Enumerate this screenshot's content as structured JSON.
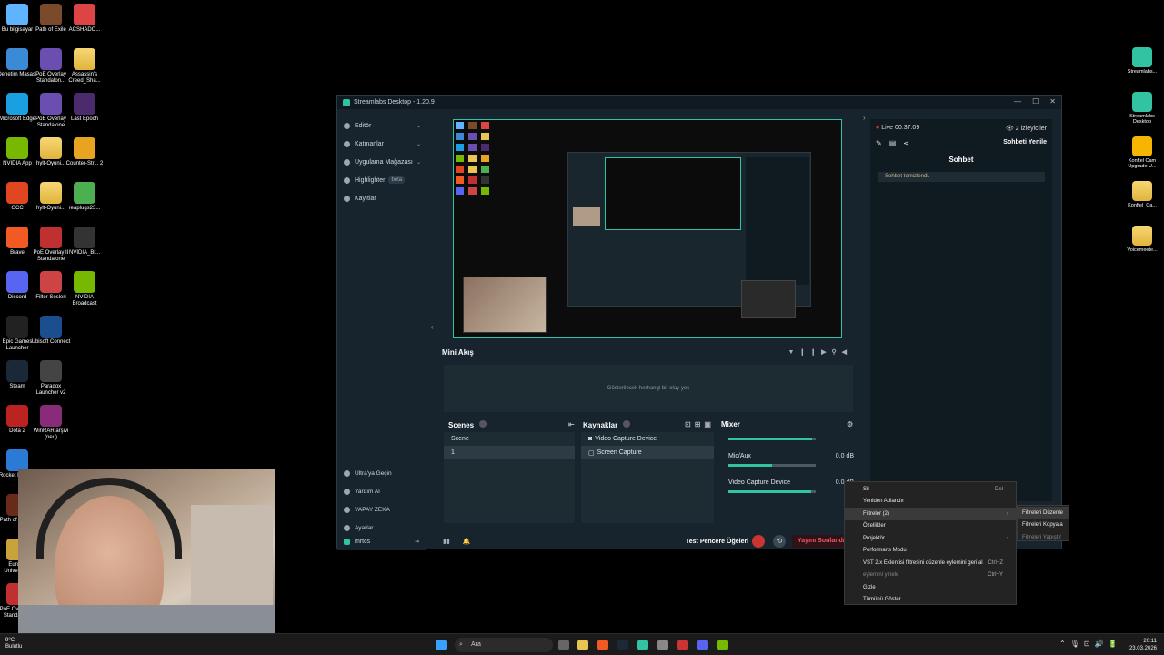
{
  "desktop_left": [
    {
      "label": "Bu bilgisayar",
      "color": "#5fb3ff"
    },
    {
      "label": "Path of Exile",
      "color": "#7a4a2a"
    },
    {
      "label": "ACSHADO...",
      "color": "#d44"
    },
    {
      "label": "Denetim Masası",
      "color": "#3a8ad6"
    },
    {
      "label": "PoE Overlay Standalon...",
      "color": "#6b4fb0"
    },
    {
      "label": "Assassin's Creed_Sha...",
      "color": "folder"
    },
    {
      "label": "Microsoft Edge",
      "color": "#1aa0e0"
    },
    {
      "label": "PoE Overlay Standalone",
      "color": "#6b4fb0"
    },
    {
      "label": "Last Epoch",
      "color": "#4b2a6e"
    },
    {
      "label": "NVIDIA App",
      "color": "#76b900"
    },
    {
      "label": "hylt-Oyuni...",
      "color": "folder"
    },
    {
      "label": "Counter-Str... 2",
      "color": "#e8a321"
    },
    {
      "label": "GCC",
      "color": "#e0461f"
    },
    {
      "label": "hylt-Oyuni...",
      "color": "folder"
    },
    {
      "label": "reaplugs23...",
      "color": "#4caf50"
    },
    {
      "label": "Brave",
      "color": "#f15a22"
    },
    {
      "label": "PoE Overlay II Standalone",
      "color": "#c03030"
    },
    {
      "label": "NVIDIA_Br...",
      "color": "#333"
    },
    {
      "label": "Discord",
      "color": "#5865f2"
    },
    {
      "label": "Filter Sesleri",
      "color": "#c44"
    },
    {
      "label": "NVIDIA Broadcast",
      "color": "#76b900"
    },
    {
      "label": "Epic Games Launcher",
      "color": "#222"
    },
    {
      "label": "Ubisoft Connect",
      "color": "#1a4e8f"
    },
    {
      "label": "Steam",
      "color": "#1b2838"
    },
    {
      "label": "Paradox Launcher v2",
      "color": "#444"
    },
    {
      "label": "Dota 2",
      "color": "#b22"
    },
    {
      "label": "WinRAR arşivi (neu)",
      "color": "#8a2b7a"
    },
    {
      "label": "Rocket League",
      "color": "#2a7bd6"
    },
    {
      "label": "Path of Exile 2",
      "color": "#6a2a1a"
    },
    {
      "label": "Europa Universalis",
      "color": "#c9a33a"
    },
    {
      "label": "PoE Overlay II Standalone",
      "color": "#c03030"
    }
  ],
  "desktop_right": [
    {
      "label": "Streamlabs...",
      "color": "#31c3a2"
    },
    {
      "label": "Streamlabs Desktop",
      "color": "#31c3a2"
    },
    {
      "label": "Konftel Cam Upgrade U...",
      "color": "#f6b500"
    },
    {
      "label": "Konftel_Ca...",
      "color": "folder"
    },
    {
      "label": "Voicemeete...",
      "color": "folder"
    }
  ],
  "window": {
    "title": "Streamlabs Desktop - 1.20.9",
    "nav": [
      {
        "label": "Editör",
        "chev": "⌄"
      },
      {
        "label": "Katmanlar",
        "chev": "⌄"
      },
      {
        "label": "Uygulama Mağazası",
        "chev": "⌄"
      },
      {
        "label": "Highlighter",
        "chev": ""
      },
      {
        "label": "Kayıtlar",
        "chev": ""
      }
    ],
    "highlighter_badge": "beta",
    "nav_bottom": [
      "Ultra'ya Geçin",
      "Yardım Al",
      "YAPAY ZEKA",
      "Ayarlar"
    ],
    "user": "mrtcs",
    "mini_feed_title": "Mini Akış",
    "mini_feed_empty": "Gösterilecek herhangi bir olay yok",
    "scenes_title": "Scenes",
    "scenes": [
      "Scene",
      "1"
    ],
    "sources_title": "Kaynaklar",
    "sources": [
      "Video Capture Device",
      "Screen Capture"
    ],
    "mixer_title": "Mixer",
    "mixer": [
      {
        "name": "Mic/Aux",
        "db": "0.0 dB",
        "level": 0.5
      },
      {
        "name": "Video Capture Device",
        "db": "0.0 dB",
        "level": 0.95
      }
    ],
    "test_label": "Test Pencere Öğeleri",
    "end_stream": "Yayını Sonlandır",
    "live_time": "Live 00:37:09",
    "viewers": "2 izleyiciler",
    "refresh_chat": "Sohbeti Yenile",
    "chat_title": "Sohbet",
    "chat_message": "Sohbet temizlendi."
  },
  "context_menu": {
    "items": [
      {
        "label": "Sil",
        "shortcut": "Del",
        "arrow": "",
        "dim": false,
        "hl": false
      },
      {
        "label": "Yeniden Adlandır",
        "shortcut": "",
        "arrow": "",
        "dim": false,
        "hl": false
      },
      {
        "label": "Filtreler (2)",
        "shortcut": "",
        "arrow": "›",
        "dim": false,
        "hl": true
      },
      {
        "label": "Özellikler",
        "shortcut": "",
        "arrow": "",
        "dim": false,
        "hl": false
      },
      {
        "label": "Projektör",
        "shortcut": "",
        "arrow": "›",
        "dim": false,
        "hl": false
      },
      {
        "label": "Performans Modu",
        "shortcut": "",
        "arrow": "",
        "dim": false,
        "hl": false
      },
      {
        "label": "VST 2.x Eklentisi filtresini düzenle eylemini geri al",
        "shortcut": "Ctrl+Z",
        "arrow": "",
        "dim": false,
        "hl": false
      },
      {
        "label": "eylemini yinele",
        "shortcut": "Ctrl+Y",
        "arrow": "",
        "dim": true,
        "hl": false
      },
      {
        "label": "Gizle",
        "shortcut": "",
        "arrow": "",
        "dim": false,
        "hl": false
      },
      {
        "label": "Tümünü Göster",
        "shortcut": "",
        "arrow": "",
        "dim": false,
        "hl": false
      }
    ],
    "submenu": [
      "Filtreleri Düzenle",
      "Filtreleri Kopyala",
      "Filtreleri Yapıştır"
    ]
  },
  "taskbar": {
    "search": "Ara",
    "weather_temp": "9°C",
    "weather_text": "Bulutlu",
    "time": "20:11",
    "date": "23.03.2026"
  }
}
